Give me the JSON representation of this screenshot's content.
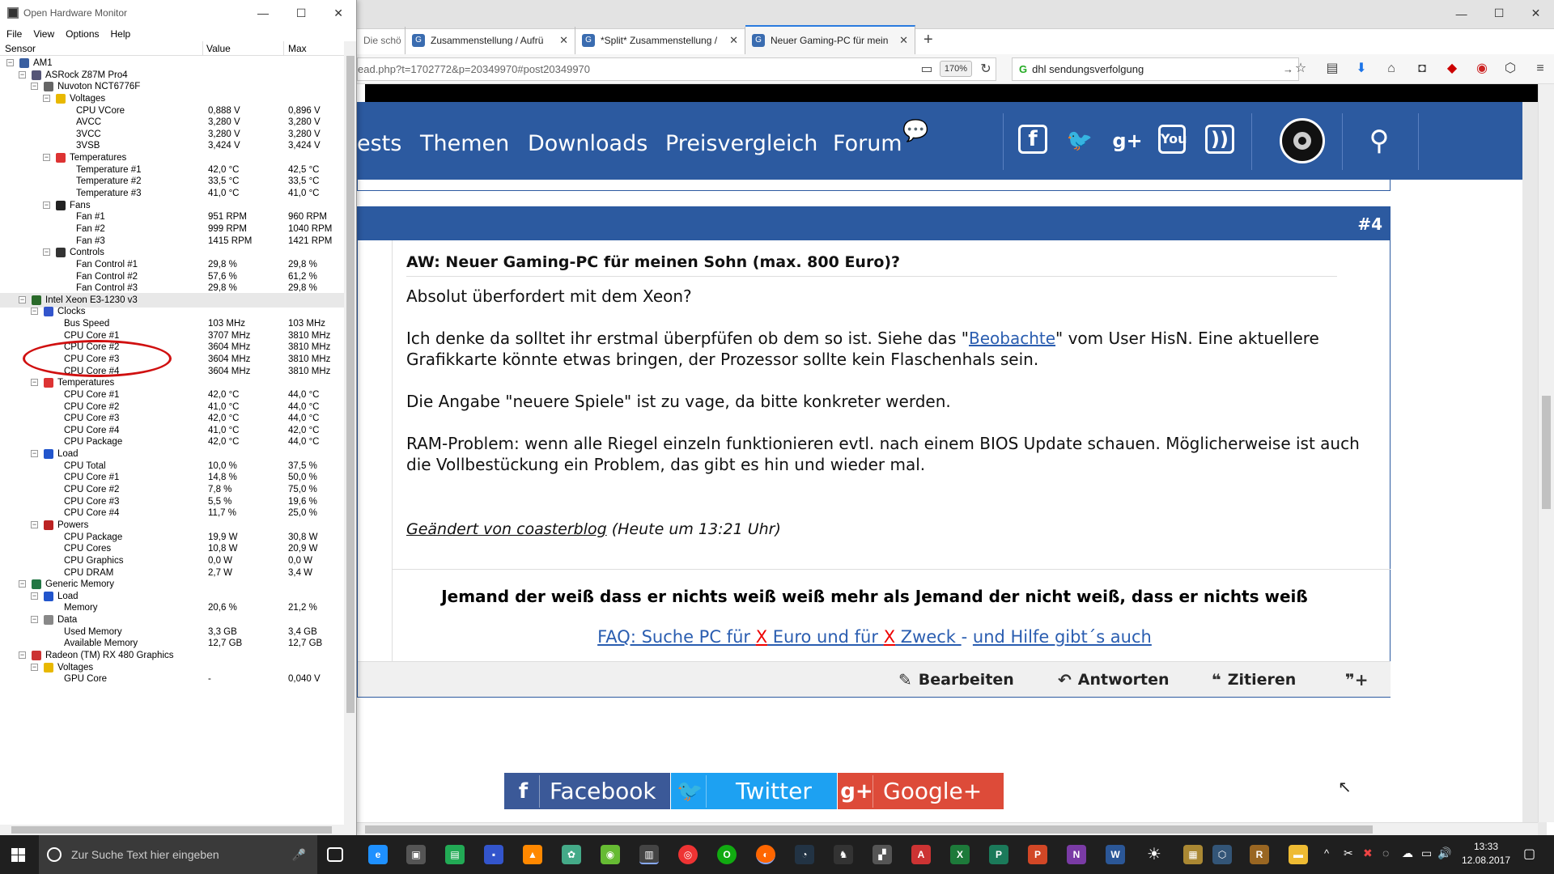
{
  "ohm": {
    "title": "Open Hardware Monitor",
    "menu": [
      "File",
      "View",
      "Options",
      "Help"
    ],
    "columns": {
      "sensor": "Sensor",
      "value": "Value",
      "max": "Max"
    },
    "rows": [
      {
        "name": "AM1",
        "value": "",
        "max": "",
        "level": 0,
        "icon": "computer",
        "exp": true
      },
      {
        "name": "ASRock Z87M Pro4",
        "value": "",
        "max": "",
        "level": 1,
        "icon": "mainboard",
        "exp": true
      },
      {
        "name": "Nuvoton NCT6776F",
        "value": "",
        "max": "",
        "level": 2,
        "icon": "chip",
        "exp": true
      },
      {
        "name": "Voltages",
        "value": "",
        "max": "",
        "level": 3,
        "icon": "voltage",
        "exp": true
      },
      {
        "name": "CPU VCore",
        "value": "0,888 V",
        "max": "0,896 V",
        "level": 4
      },
      {
        "name": "AVCC",
        "value": "3,280 V",
        "max": "3,280 V",
        "level": 4
      },
      {
        "name": "3VCC",
        "value": "3,280 V",
        "max": "3,280 V",
        "level": 4
      },
      {
        "name": "3VSB",
        "value": "3,424 V",
        "max": "3,424 V",
        "level": 4
      },
      {
        "name": "Temperatures",
        "value": "",
        "max": "",
        "level": 3,
        "icon": "temperature",
        "exp": true
      },
      {
        "name": "Temperature #1",
        "value": "42,0 °C",
        "max": "42,5 °C",
        "level": 4
      },
      {
        "name": "Temperature #2",
        "value": "33,5 °C",
        "max": "33,5 °C",
        "level": 4
      },
      {
        "name": "Temperature #3",
        "value": "41,0 °C",
        "max": "41,0 °C",
        "level": 4
      },
      {
        "name": "Fans",
        "value": "",
        "max": "",
        "level": 3,
        "icon": "fan",
        "exp": true
      },
      {
        "name": "Fan #1",
        "value": "951 RPM",
        "max": "960 RPM",
        "level": 4
      },
      {
        "name": "Fan #2",
        "value": "999 RPM",
        "max": "1040 RPM",
        "level": 4
      },
      {
        "name": "Fan #3",
        "value": "1415 RPM",
        "max": "1421 RPM",
        "level": 4
      },
      {
        "name": "Controls",
        "value": "",
        "max": "",
        "level": 3,
        "icon": "control",
        "exp": true
      },
      {
        "name": "Fan Control #1",
        "value": "29,8 %",
        "max": "29,8 %",
        "level": 4
      },
      {
        "name": "Fan Control #2",
        "value": "57,6 %",
        "max": "61,2 %",
        "level": 4
      },
      {
        "name": "Fan Control #3",
        "value": "29,8 %",
        "max": "29,8 %",
        "level": 4
      },
      {
        "name": "Intel Xeon E3-1230 v3",
        "value": "",
        "max": "",
        "level": 1,
        "icon": "cpu",
        "exp": true,
        "selected": true
      },
      {
        "name": "Clocks",
        "value": "",
        "max": "",
        "level": 2,
        "icon": "clock",
        "exp": true
      },
      {
        "name": "Bus Speed",
        "value": "103 MHz",
        "max": "103 MHz",
        "level": 3
      },
      {
        "name": "CPU Core #1",
        "value": "3707 MHz",
        "max": "3810 MHz",
        "level": 3
      },
      {
        "name": "CPU Core #2",
        "value": "3604 MHz",
        "max": "3810 MHz",
        "level": 3
      },
      {
        "name": "CPU Core #3",
        "value": "3604 MHz",
        "max": "3810 MHz",
        "level": 3
      },
      {
        "name": "CPU Core #4",
        "value": "3604 MHz",
        "max": "3810 MHz",
        "level": 3
      },
      {
        "name": "Temperatures",
        "value": "",
        "max": "",
        "level": 2,
        "icon": "temperature",
        "exp": true
      },
      {
        "name": "CPU Core #1",
        "value": "42,0 °C",
        "max": "44,0 °C",
        "level": 3
      },
      {
        "name": "CPU Core #2",
        "value": "41,0 °C",
        "max": "44,0 °C",
        "level": 3
      },
      {
        "name": "CPU Core #3",
        "value": "42,0 °C",
        "max": "44,0 °C",
        "level": 3
      },
      {
        "name": "CPU Core #4",
        "value": "41,0 °C",
        "max": "42,0 °C",
        "level": 3
      },
      {
        "name": "CPU Package",
        "value": "42,0 °C",
        "max": "44,0 °C",
        "level": 3
      },
      {
        "name": "Load",
        "value": "",
        "max": "",
        "level": 2,
        "icon": "load",
        "exp": true
      },
      {
        "name": "CPU Total",
        "value": "10,0 %",
        "max": "37,5 %",
        "level": 3
      },
      {
        "name": "CPU Core #1",
        "value": "14,8 %",
        "max": "50,0 %",
        "level": 3
      },
      {
        "name": "CPU Core #2",
        "value": "7,8 %",
        "max": "75,0 %",
        "level": 3
      },
      {
        "name": "CPU Core #3",
        "value": "5,5 %",
        "max": "19,6 %",
        "level": 3
      },
      {
        "name": "CPU Core #4",
        "value": "11,7 %",
        "max": "25,0 %",
        "level": 3
      },
      {
        "name": "Powers",
        "value": "",
        "max": "",
        "level": 2,
        "icon": "power",
        "exp": true
      },
      {
        "name": "CPU Package",
        "value": "19,9 W",
        "max": "30,8 W",
        "level": 3
      },
      {
        "name": "CPU Cores",
        "value": "10,8 W",
        "max": "20,9 W",
        "level": 3
      },
      {
        "name": "CPU Graphics",
        "value": "0,0 W",
        "max": "0,0 W",
        "level": 3
      },
      {
        "name": "CPU DRAM",
        "value": "2,7 W",
        "max": "3,4 W",
        "level": 3
      },
      {
        "name": "Generic Memory",
        "value": "",
        "max": "",
        "level": 1,
        "icon": "memory",
        "exp": true
      },
      {
        "name": "Load",
        "value": "",
        "max": "",
        "level": 2,
        "icon": "load",
        "exp": true
      },
      {
        "name": "Memory",
        "value": "20,6 %",
        "max": "21,2 %",
        "level": 3
      },
      {
        "name": "Data",
        "value": "",
        "max": "",
        "level": 2,
        "icon": "data",
        "exp": true
      },
      {
        "name": "Used Memory",
        "value": "3,3 GB",
        "max": "3,4 GB",
        "level": 3
      },
      {
        "name": "Available Memory",
        "value": "12,7 GB",
        "max": "12,7 GB",
        "level": 3
      },
      {
        "name": "Radeon (TM) RX 480 Graphics",
        "value": "",
        "max": "",
        "level": 1,
        "icon": "gpu",
        "exp": true
      },
      {
        "name": "Voltages",
        "value": "",
        "max": "",
        "level": 2,
        "icon": "voltage",
        "exp": true
      },
      {
        "name": "GPU Core",
        "value": "-",
        "max": "0,040 V",
        "level": 3
      }
    ]
  },
  "browser": {
    "tabs": [
      {
        "title": "Die schö",
        "active": false
      },
      {
        "title": "Zusammenstellung / Aufrü",
        "active": false
      },
      {
        "title": "*Split* Zusammenstellung /",
        "active": false
      },
      {
        "title": "Neuer Gaming-PC für mein",
        "active": true
      }
    ],
    "url": "ead.php?t=1702772&p=20349970#post20349970",
    "zoom": "170%",
    "search": "dhl sendungsverfolgung"
  },
  "site": {
    "nav": [
      "ests",
      "Themen",
      "Downloads",
      "Preisvergleich",
      "Forum"
    ],
    "post": {
      "number": "#4",
      "title": "AW: Neuer Gaming-PC für meinen Sohn (max. 800 Euro)?",
      "p1": "Absolut überfordert mit dem Xeon?",
      "p2a": "Ich denke da solltet ihr erstmal überpfüfen ob dem so ist. Siehe das \"",
      "p2link": "Beobachte",
      "p2b": "\" vom User HisN. Eine aktuellere Grafikkarte könnte etwas bringen, der Prozessor sollte kein Flaschenhals sein.",
      "p3": "Die Angabe \"neuere Spiele\" ist zu vage, da bitte konkreter werden.",
      "p4": "RAM-Problem: wenn alle Riegel einzeln funktionieren evtl. nach einem BIOS Update schauen. Möglicherweise ist auch die Vollbestückung ein Problem, das gibt es hin und wieder mal.",
      "edited_link": "Geändert von coasterblog",
      "edited_time": " (Heute um 13:21 Uhr)",
      "sig_bold": "Jemand der weiß dass er nichts weiß weiß mehr als Jemand der nicht weiß, dass er nichts weiß",
      "faq1": "FAQ: Suche PC für ",
      "faqx1": "X",
      "faq2": " Euro und für ",
      "faqx2": "X",
      "faq3": " Zweck ",
      "faqsep": "- ",
      "faq4": "und Hilfe gibt´s auch",
      "actions": {
        "edit": "Bearbeiten",
        "reply": "Antworten",
        "quote": "Zitieren"
      }
    },
    "share": {
      "facebook": "Facebook",
      "twitter": "Twitter",
      "google": "Google+"
    }
  },
  "taskbar": {
    "search_placeholder": "Zur Suche Text hier eingeben",
    "time": "13:33",
    "date": "12.08.2017"
  },
  "colors": {
    "site_blue": "#2c5aa0",
    "facebook": "#3b5998",
    "twitter": "#1da1f2",
    "google": "#dd4b39"
  }
}
